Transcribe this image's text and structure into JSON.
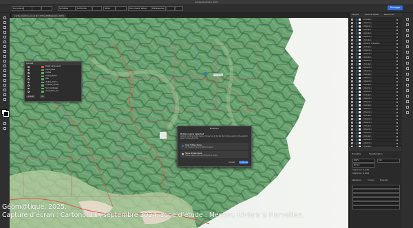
{
  "window": {
    "title": "Adobe Illustrator 2024"
  },
  "controlbar": {
    "share_label": "Partager",
    "items": [
      "Aucune sélection",
      "",
      "",
      "",
      "Symbole",
      "Uniforme",
      "",
      "Style",
      "",
      "Document Setup",
      "Préférences",
      "",
      ""
    ]
  },
  "document": {
    "tab_title": "carte_menton_v4.ai @ 12,5% (RVB/Aperçu GPU)"
  },
  "layer_options_panel": {
    "title": "Calques",
    "rows": [
      {
        "label": "Relief_carte_ajout"
      },
      {
        "label": "toponymes"
      },
      {
        "label": "routes"
      },
      {
        "label": "hydrographie"
      },
      {
        "label": "bati"
      },
      {
        "label": "limites_admin"
      },
      {
        "label": "courbes_niveau"
      },
      {
        "label": "fond_ombrage"
      },
      {
        "label": "occupation_sol"
      }
    ],
    "buttons": [
      "Annuler",
      "OK"
    ]
  },
  "dialog": {
    "title": "Illustrator",
    "heading": "Hidden items detected",
    "body": "Artwork contains hidden items. Choose how to handle them when exporting the selected layers to the output file.",
    "options": [
      {
        "title": "Crop hidden items",
        "desc": "All unneeded objects will be cropped.",
        "selected": true
      },
      {
        "title": "Show hidden items",
        "desc": "Hidden objects will be included and shown.",
        "selected": false
      }
    ],
    "cancel_label": "Annuler",
    "ok_label": "Continuer"
  },
  "layers_panel": {
    "tabs": [
      "Calques",
      "Plans de travail",
      "Ressources"
    ],
    "rows": [
      {
        "label": "<Groupe>"
      },
      {
        "label": "<Chemin>"
      },
      {
        "label": "<Chemin>"
      },
      {
        "label": "<Groupe>"
      },
      {
        "label": "<Groupe>"
      },
      {
        "label": "<Chemin>"
      },
      {
        "label": "<Groupe>"
      },
      {
        "label": "<Chemin composé>"
      },
      {
        "label": "<Groupe>"
      },
      {
        "label": "<Chemin>"
      },
      {
        "label": "<Chemin>"
      },
      {
        "label": "<Groupe>"
      },
      {
        "label": "<Chemin>"
      },
      {
        "label": "<Groupe>"
      },
      {
        "label": "<Chemin>"
      },
      {
        "label": "<Chemin>"
      },
      {
        "label": "<Groupe>"
      },
      {
        "label": "<Chemin>"
      },
      {
        "label": "<Chemin>"
      },
      {
        "label": "<Groupe>"
      },
      {
        "label": "<Chemin>"
      },
      {
        "label": "<Chemin>"
      },
      {
        "label": "<Groupe>"
      },
      {
        "label": "<Chemin>"
      },
      {
        "label": "<Chemin>"
      },
      {
        "label": "<Groupe>"
      },
      {
        "label": "<Chemin>"
      },
      {
        "label": "<Chemin>"
      },
      {
        "label": "<Groupe>"
      },
      {
        "label": "<Chemin>"
      },
      {
        "label": "<Chemin>"
      },
      {
        "label": "<Groupe>"
      },
      {
        "label": "<Chemin>"
      },
      {
        "label": "<Chemin>"
      },
      {
        "label": "<Groupe>"
      },
      {
        "label": "<Chemin>"
      },
      {
        "label": "<Chemin>"
      },
      {
        "label": "<Groupe>"
      }
    ]
  },
  "properties_panel": {
    "tabs": [
      "Propriétés",
      "Transformation"
    ],
    "fields": [
      "100 %",
      "0 pt",
      "Normal"
    ],
    "checkbox_labels": [
      "Aligner sur la grille",
      "Aligner sur le pixel"
    ],
    "section_tabs": [
      "Apparence",
      "Couleur",
      "Nuancier"
    ]
  },
  "credit": {
    "line1": "Géom@tique, 2025.",
    "line2": "Capture d’écran : Cartonord®, septembre 2024, zone d’étude : Menton, Riviera & Merveilles."
  },
  "colors": {
    "accent": "#2f6fd6",
    "panel_bg": "#2a2a2a",
    "map_forest": "#5f9a6a",
    "map_sea": "#eef1ef"
  }
}
